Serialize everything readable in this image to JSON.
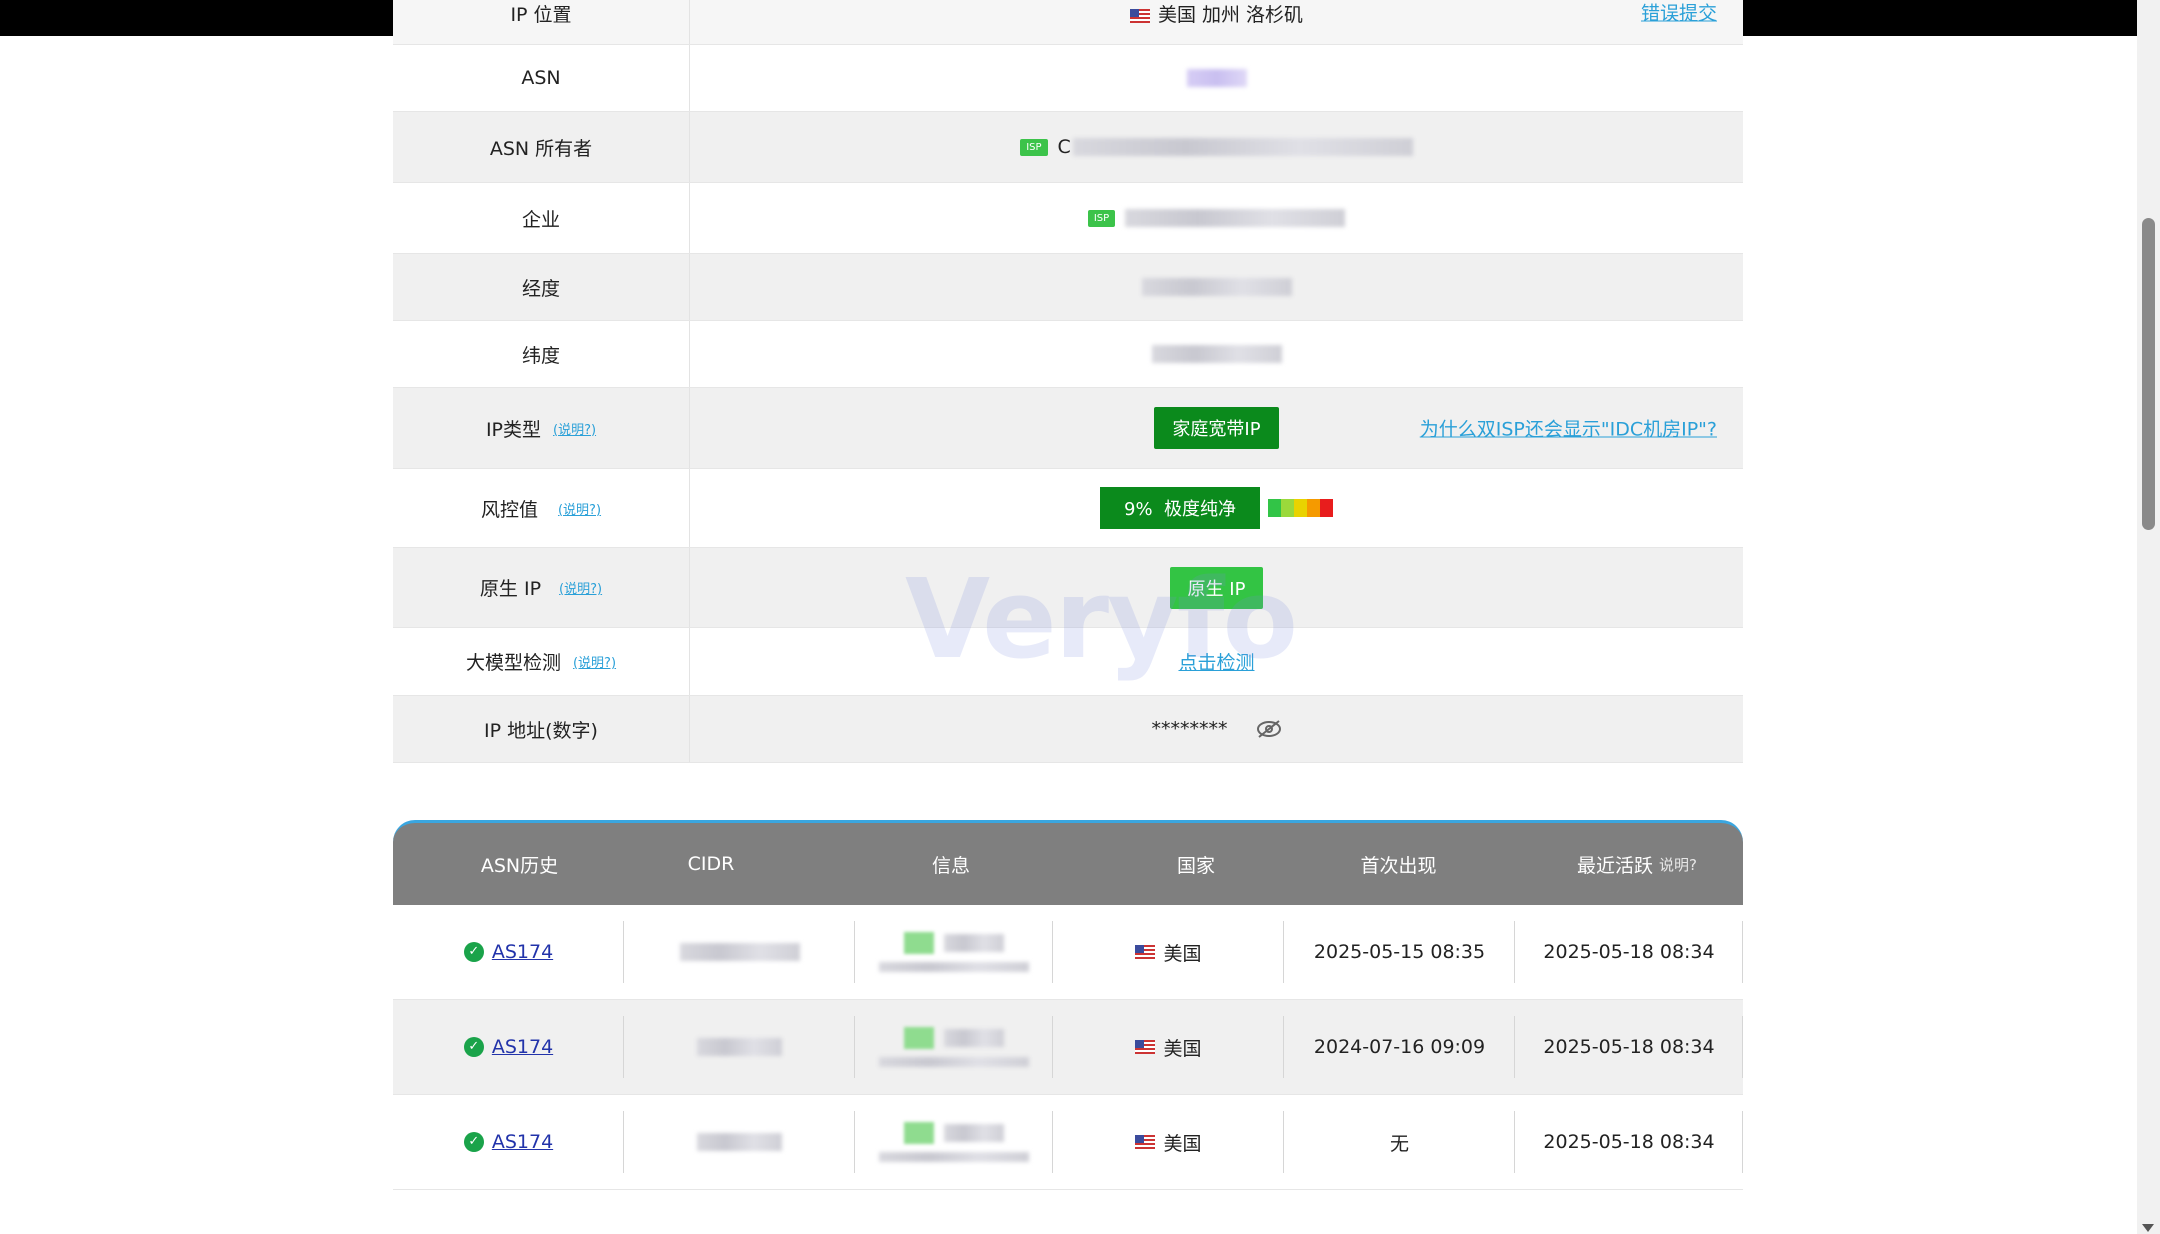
{
  "info_rows": [
    {
      "label": "IP 位置",
      "hint": "",
      "value": "美国 加州 洛杉矶",
      "right_link": "错误提交"
    },
    {
      "label": "ASN",
      "hint": ""
    },
    {
      "label": "ASN 所有者",
      "hint": "",
      "isp_badge": "ISP",
      "value_prefix": "C"
    },
    {
      "label": "企业",
      "hint": "",
      "isp_badge": "ISP"
    },
    {
      "label": "经度",
      "hint": ""
    },
    {
      "label": "纬度",
      "hint": ""
    },
    {
      "label": "IP类型",
      "hint": "(说明?)",
      "value": "家庭宽带IP",
      "right_link": "为什么双ISP还会显示\"IDC机房IP\"?"
    },
    {
      "label": "风控值",
      "hint": "(说明?)",
      "value": "9%  极度纯净"
    },
    {
      "label": "原生 IP",
      "hint": "(说明?)",
      "value": "原生 IP"
    },
    {
      "label": "大模型检测",
      "hint": "(说明?)",
      "value": "点击检测"
    },
    {
      "label": "IP 地址(数字)",
      "hint": "",
      "value": "********"
    }
  ],
  "risk_bar_colors": [
    "#32c447",
    "#9bd93b",
    "#e9d300",
    "#f59a00",
    "#e81d1d"
  ],
  "watermark": "Veryfo",
  "history": {
    "headers": {
      "asn": "ASN历史",
      "cidr": "CIDR",
      "info": "信息",
      "country": "国家",
      "first": "首次出现",
      "last": "最近活跃",
      "last_hint": "说明?"
    },
    "rows": [
      {
        "asn": "AS174",
        "country": "美国",
        "first": "2025-05-15 08:35",
        "last": "2025-05-18 08:34"
      },
      {
        "asn": "AS174",
        "country": "美国",
        "first": "2024-07-16 09:09",
        "last": "2025-05-18 08:34"
      },
      {
        "asn": "AS174",
        "country": "美国",
        "first": "无",
        "last": "2025-05-18 08:34"
      }
    ]
  }
}
